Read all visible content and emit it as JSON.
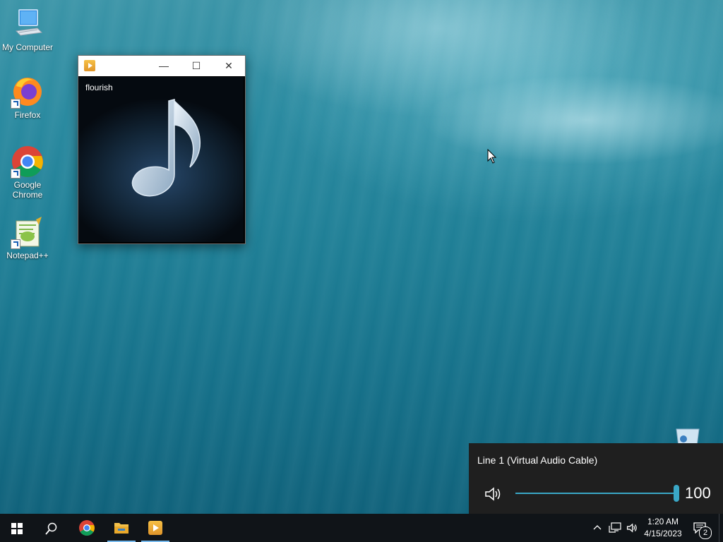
{
  "desktop": {
    "icons": [
      {
        "label": "My Computer",
        "icon": "computer-icon"
      },
      {
        "label": "Firefox",
        "icon": "firefox-icon"
      },
      {
        "label": "Google Chrome",
        "icon": "chrome-icon"
      },
      {
        "label": "Notepad++",
        "icon": "notepad-plus-plus-icon"
      }
    ]
  },
  "player_window": {
    "title": "",
    "minimize": "—",
    "maximize": "☐",
    "close": "✕",
    "track_name": "flourish"
  },
  "volume_flyout": {
    "device": "Line 1 (Virtual Audio Cable)",
    "level": 100,
    "level_label": "100",
    "accent": "#3aa7c6"
  },
  "taskbar": {
    "time": "1:20 AM",
    "date": "4/15/2023",
    "notification_count": "2",
    "pinned": [
      "start-icon",
      "search-icon",
      "chrome-icon",
      "file-explorer-icon",
      "media-player-icon"
    ]
  }
}
